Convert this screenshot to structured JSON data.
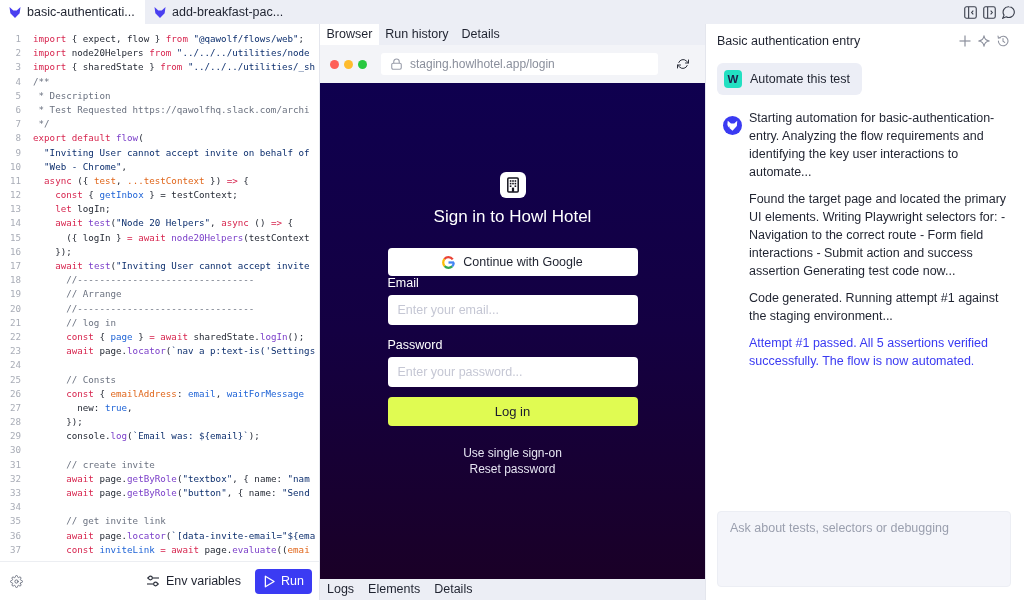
{
  "tabs": [
    {
      "label": "basic-authenticati...",
      "selected": true
    },
    {
      "label": "add-breakfast-pac...",
      "selected": false
    }
  ],
  "editor": {
    "lines": [
      {
        "number": "1",
        "tokens": [
          {
            "kind": "kw",
            "text": "import"
          },
          {
            "kind": "plain",
            "text": " { expect, flow } "
          },
          {
            "kind": "kw",
            "text": "from "
          },
          {
            "kind": "str",
            "text": "\"@qawolf/flows/web\""
          },
          {
            "kind": "plain",
            "text": ";"
          }
        ]
      },
      {
        "number": "2",
        "tokens": [
          {
            "kind": "kw",
            "text": "import"
          },
          {
            "kind": "plain",
            "text": " node20Helpers "
          },
          {
            "kind": "kw",
            "text": "from "
          },
          {
            "kind": "str",
            "text": "\"../../../utilities/node"
          }
        ]
      },
      {
        "number": "3",
        "tokens": [
          {
            "kind": "kw",
            "text": "import"
          },
          {
            "kind": "plain",
            "text": " { sharedState } "
          },
          {
            "kind": "kw",
            "text": "from "
          },
          {
            "kind": "str",
            "text": "\"../../../utilities/_sh"
          }
        ]
      },
      {
        "number": "4",
        "tokens": [
          {
            "kind": "cmt",
            "text": "/**"
          }
        ]
      },
      {
        "number": "5",
        "tokens": [
          {
            "kind": "cmt",
            "text": " * Description"
          }
        ]
      },
      {
        "number": "6",
        "tokens": [
          {
            "kind": "cmt",
            "text": " * Test Requested https://qawolfhq.slack.com/archi"
          }
        ]
      },
      {
        "number": "7",
        "tokens": [
          {
            "kind": "cmt",
            "text": " */"
          }
        ]
      },
      {
        "number": "8",
        "tokens": [
          {
            "kind": "kw",
            "text": "export default "
          },
          {
            "kind": "fn",
            "text": "flow"
          },
          {
            "kind": "plain",
            "text": "("
          }
        ]
      },
      {
        "number": "9",
        "tokens": [
          {
            "kind": "str",
            "text": "  \"Inviting User cannot accept invite on behalf of"
          }
        ]
      },
      {
        "number": "10",
        "tokens": [
          {
            "kind": "str",
            "text": "  \"Web - Chrome\""
          },
          {
            "kind": "plain",
            "text": ","
          }
        ]
      },
      {
        "number": "11",
        "tokens": [
          {
            "kind": "kw",
            "text": "  async"
          },
          {
            "kind": "plain",
            "text": " ({ "
          },
          {
            "kind": "param",
            "text": "test"
          },
          {
            "kind": "plain",
            "text": ", "
          },
          {
            "kind": "param",
            "text": "...testContext"
          },
          {
            "kind": "plain",
            "text": " }) "
          },
          {
            "kind": "kw",
            "text": "=>"
          },
          {
            "kind": "plain",
            "text": " {"
          }
        ]
      },
      {
        "number": "12",
        "tokens": [
          {
            "kind": "kw",
            "text": "    const"
          },
          {
            "kind": "plain",
            "text": " { "
          },
          {
            "kind": "var",
            "text": "getInbox"
          },
          {
            "kind": "plain",
            "text": " } = testContext;"
          }
        ]
      },
      {
        "number": "13",
        "tokens": [
          {
            "kind": "kw",
            "text": "    let"
          },
          {
            "kind": "plain",
            "text": " logIn;"
          }
        ]
      },
      {
        "number": "14",
        "tokens": [
          {
            "kind": "kw",
            "text": "    await "
          },
          {
            "kind": "fn",
            "text": "test"
          },
          {
            "kind": "plain",
            "text": "("
          },
          {
            "kind": "str",
            "text": "\"Node 20 Helpers\""
          },
          {
            "kind": "plain",
            "text": ", "
          },
          {
            "kind": "kw",
            "text": "async"
          },
          {
            "kind": "plain",
            "text": " () "
          },
          {
            "kind": "kw",
            "text": "=>"
          },
          {
            "kind": "plain",
            "text": " {"
          }
        ]
      },
      {
        "number": "15",
        "tokens": [
          {
            "kind": "plain",
            "text": "      ({ logIn } "
          },
          {
            "kind": "kw",
            "text": "= await "
          },
          {
            "kind": "fn",
            "text": "node20Helpers"
          },
          {
            "kind": "plain",
            "text": "(testContext"
          }
        ]
      },
      {
        "number": "16",
        "tokens": [
          {
            "kind": "plain",
            "text": "    });"
          }
        ]
      },
      {
        "number": "17",
        "tokens": [
          {
            "kind": "kw",
            "text": "    await "
          },
          {
            "kind": "fn",
            "text": "test"
          },
          {
            "kind": "plain",
            "text": "("
          },
          {
            "kind": "str",
            "text": "\"Inviting User cannot accept invite"
          }
        ]
      },
      {
        "number": "18",
        "tokens": [
          {
            "kind": "cmt",
            "text": "      //--------------------------------"
          }
        ]
      },
      {
        "number": "19",
        "tokens": [
          {
            "kind": "cmt",
            "text": "      // Arrange"
          }
        ]
      },
      {
        "number": "20",
        "tokens": [
          {
            "kind": "cmt",
            "text": "      //--------------------------------"
          }
        ]
      },
      {
        "number": "21",
        "tokens": [
          {
            "kind": "cmt",
            "text": "      // log in"
          }
        ]
      },
      {
        "number": "22",
        "tokens": [
          {
            "kind": "kw",
            "text": "      const"
          },
          {
            "kind": "plain",
            "text": " { "
          },
          {
            "kind": "var",
            "text": "page"
          },
          {
            "kind": "plain",
            "text": " } "
          },
          {
            "kind": "kw",
            "text": "= await"
          },
          {
            "kind": "plain",
            "text": " sharedState."
          },
          {
            "kind": "fn",
            "text": "logIn"
          },
          {
            "kind": "plain",
            "text": "();"
          }
        ]
      },
      {
        "number": "23",
        "tokens": [
          {
            "kind": "kw",
            "text": "      await"
          },
          {
            "kind": "plain",
            "text": " page."
          },
          {
            "kind": "fn",
            "text": "locator"
          },
          {
            "kind": "plain",
            "text": "("
          },
          {
            "kind": "str",
            "text": "`nav a p:text-is('Settings"
          }
        ]
      },
      {
        "number": "24"
      },
      {
        "number": "25",
        "tokens": [
          {
            "kind": "cmt",
            "text": "      // Consts"
          }
        ]
      },
      {
        "number": "26",
        "tokens": [
          {
            "kind": "kw",
            "text": "      const"
          },
          {
            "kind": "plain",
            "text": " { "
          },
          {
            "kind": "param",
            "text": "emailAddress"
          },
          {
            "kind": "plain",
            "text": ": "
          },
          {
            "kind": "var",
            "text": "email"
          },
          {
            "kind": "plain",
            "text": ", "
          },
          {
            "kind": "var",
            "text": "waitForMessage"
          }
        ]
      },
      {
        "number": "27",
        "tokens": [
          {
            "kind": "plain",
            "text": "        new: "
          },
          {
            "kind": "var",
            "text": "true"
          },
          {
            "kind": "plain",
            "text": ","
          }
        ]
      },
      {
        "number": "28",
        "tokens": [
          {
            "kind": "plain",
            "text": "      });"
          }
        ]
      },
      {
        "number": "29",
        "tokens": [
          {
            "kind": "plain",
            "text": "      console."
          },
          {
            "kind": "fn",
            "text": "log"
          },
          {
            "kind": "plain",
            "text": "("
          },
          {
            "kind": "str",
            "text": "`Email was: ${email}`"
          },
          {
            "kind": "plain",
            "text": ");"
          }
        ]
      },
      {
        "number": "30"
      },
      {
        "number": "31",
        "tokens": [
          {
            "kind": "cmt",
            "text": "      // create invite"
          }
        ]
      },
      {
        "number": "32",
        "tokens": [
          {
            "kind": "kw",
            "text": "      await"
          },
          {
            "kind": "plain",
            "text": " page."
          },
          {
            "kind": "fn",
            "text": "getByRole"
          },
          {
            "kind": "plain",
            "text": "("
          },
          {
            "kind": "str",
            "text": "\"textbox\""
          },
          {
            "kind": "plain",
            "text": ", { name: "
          },
          {
            "kind": "str",
            "text": "\"nam"
          }
        ]
      },
      {
        "number": "33",
        "tokens": [
          {
            "kind": "kw",
            "text": "      await"
          },
          {
            "kind": "plain",
            "text": " page."
          },
          {
            "kind": "fn",
            "text": "getByRole"
          },
          {
            "kind": "plain",
            "text": "("
          },
          {
            "kind": "str",
            "text": "\"button\""
          },
          {
            "kind": "plain",
            "text": ", { name: "
          },
          {
            "kind": "str",
            "text": "\"Send"
          }
        ]
      },
      {
        "number": "34"
      },
      {
        "number": "35",
        "tokens": [
          {
            "kind": "cmt",
            "text": "      // get invite link"
          }
        ]
      },
      {
        "number": "36",
        "tokens": [
          {
            "kind": "kw",
            "text": "      await"
          },
          {
            "kind": "plain",
            "text": " page."
          },
          {
            "kind": "fn",
            "text": "locator"
          },
          {
            "kind": "plain",
            "text": "("
          },
          {
            "kind": "str",
            "text": "`[data-invite-email=\"${ema"
          }
        ]
      },
      {
        "number": "37",
        "tokens": [
          {
            "kind": "kw",
            "text": "      const "
          },
          {
            "kind": "var",
            "text": "inviteLink "
          },
          {
            "kind": "kw",
            "text": "= await"
          },
          {
            "kind": "plain",
            "text": " page."
          },
          {
            "kind": "fn",
            "text": "evaluate"
          },
          {
            "kind": "plain",
            "text": "(("
          },
          {
            "kind": "param",
            "text": "emai"
          }
        ]
      }
    ],
    "env_button": "Env variables",
    "run_button": "Run"
  },
  "browser": {
    "tabs": [
      {
        "label": "Browser",
        "selected": true
      },
      {
        "label": "Run history",
        "selected": false
      },
      {
        "label": "Details",
        "selected": false
      }
    ],
    "address": "staging.howlhotel.app/login",
    "page": {
      "title": "Sign in to Howl Hotel",
      "google_button": "Continue with Google",
      "fields": [
        {
          "label": "Email",
          "placeholder": "Enter your email..."
        },
        {
          "label": "Password",
          "placeholder": "Enter your password..."
        }
      ],
      "submit_button": "Log in",
      "links": [
        "Use single sign-on",
        "Reset password"
      ]
    },
    "bottom_tabs": [
      {
        "label": "Logs",
        "selected": false
      },
      {
        "label": "Elements",
        "selected": false
      },
      {
        "label": "Details",
        "selected": false
      }
    ]
  },
  "chat": {
    "title": "Basic authentication entry",
    "messages": [
      {
        "kind": "user",
        "avatar": "W",
        "text": "Automate this test"
      },
      {
        "kind": "assistant",
        "paragraphs": [
          {
            "text": "Starting automation for basic-authentication-entry. Analyzing the flow requirements and identifying the key user interactions to automate...",
            "highlighted": false
          },
          {
            "text": "Found the target page and located the primary UI elements. Writing Playwright selectors for: - Navigation to the correct route - Form field interactions - Submit action and success assertion Generating test code now...",
            "highlighted": false
          },
          {
            "text": "Code generated. Running attempt #1 against the staging environment...",
            "highlighted": false
          },
          {
            "text": "Attempt #1 passed. All 5 assertions verified successfully. The flow is now automated.",
            "highlighted": true
          }
        ]
      }
    ],
    "input": {
      "placeholder": "Ask about tests, selectors or debugging"
    }
  }
}
